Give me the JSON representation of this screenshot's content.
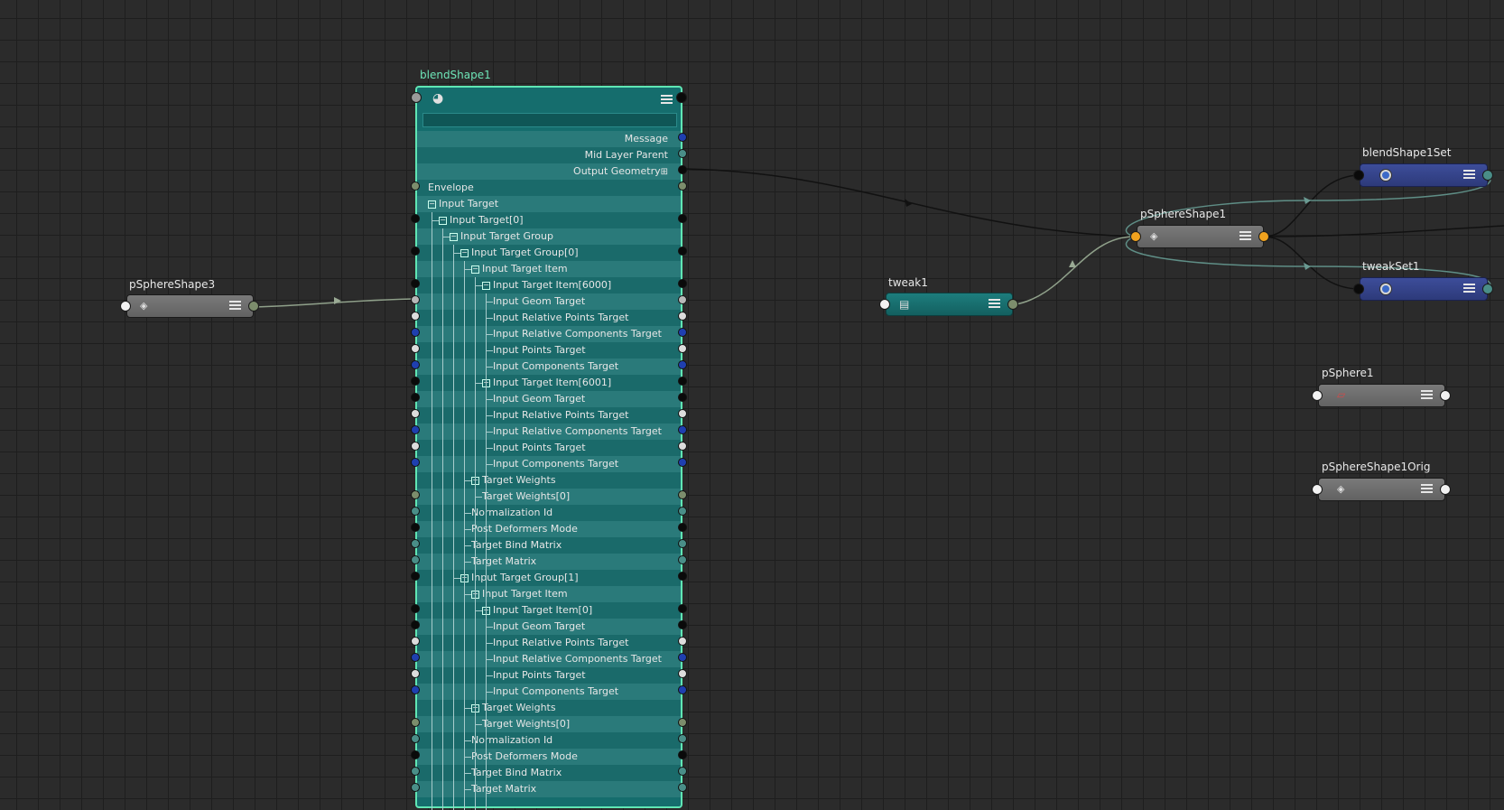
{
  "nodes": {
    "blendShape": {
      "title": "blendShape1",
      "rows": [
        {
          "label": "Message",
          "side": "out",
          "port": "blue"
        },
        {
          "label": "Mid Layer Parent",
          "side": "out",
          "port": "teal"
        },
        {
          "label": "Output Geometry",
          "side": "out",
          "port": "black",
          "expander": "⊞"
        },
        {
          "label": "Envelope",
          "side": "in",
          "depth": 0,
          "port": "olive"
        },
        {
          "label": "Input Target",
          "side": "in",
          "depth": 0,
          "collapse": true,
          "port": "none"
        },
        {
          "label": "Input Target[0]",
          "side": "in",
          "depth": 1,
          "collapse": true,
          "port": "black"
        },
        {
          "label": "Input Target Group",
          "side": "in",
          "depth": 2,
          "collapse": true,
          "port": "none"
        },
        {
          "label": "Input Target Group[0]",
          "side": "in",
          "depth": 3,
          "collapse": true,
          "port": "black"
        },
        {
          "label": "Input Target Item",
          "side": "in",
          "depth": 4,
          "collapse": true,
          "port": "none"
        },
        {
          "label": "Input Target Item[6000]",
          "side": "in",
          "depth": 5,
          "collapse": true,
          "port": "black"
        },
        {
          "label": "Input Geom Target",
          "side": "in",
          "depth": 6,
          "port": "gray"
        },
        {
          "label": "Input Relative Points Target",
          "side": "in",
          "depth": 6,
          "port": "white"
        },
        {
          "label": "Input Relative Components Target",
          "side": "in",
          "depth": 6,
          "port": "blue"
        },
        {
          "label": "Input Points Target",
          "side": "in",
          "depth": 6,
          "port": "white"
        },
        {
          "label": "Input Components Target",
          "side": "in",
          "depth": 6,
          "port": "blue"
        },
        {
          "label": "Input Target Item[6001]",
          "side": "in",
          "depth": 5,
          "collapse": true,
          "port": "black"
        },
        {
          "label": "Input Geom Target",
          "side": "in",
          "depth": 6,
          "port": "black"
        },
        {
          "label": "Input Relative Points Target",
          "side": "in",
          "depth": 6,
          "port": "white"
        },
        {
          "label": "Input Relative Components Target",
          "side": "in",
          "depth": 6,
          "port": "blue"
        },
        {
          "label": "Input Points Target",
          "side": "in",
          "depth": 6,
          "port": "white"
        },
        {
          "label": "Input Components Target",
          "side": "in",
          "depth": 6,
          "port": "blue"
        },
        {
          "label": "Target Weights",
          "side": "in",
          "depth": 4,
          "collapse": true,
          "port": "none"
        },
        {
          "label": "Target Weights[0]",
          "side": "in",
          "depth": 5,
          "port": "olive"
        },
        {
          "label": "Normalization Id",
          "side": "in",
          "depth": 4,
          "port": "teal"
        },
        {
          "label": "Post Deformers Mode",
          "side": "in",
          "depth": 4,
          "port": "black"
        },
        {
          "label": "Target Bind Matrix",
          "side": "in",
          "depth": 4,
          "port": "teal"
        },
        {
          "label": "Target Matrix",
          "side": "in",
          "depth": 4,
          "port": "teal"
        },
        {
          "label": "Input Target Group[1]",
          "side": "in",
          "depth": 3,
          "collapse": true,
          "port": "black"
        },
        {
          "label": "Input Target Item",
          "side": "in",
          "depth": 4,
          "collapse": true,
          "port": "none"
        },
        {
          "label": "Input Target Item[0]",
          "side": "in",
          "depth": 5,
          "collapse": true,
          "port": "black"
        },
        {
          "label": "Input Geom Target",
          "side": "in",
          "depth": 6,
          "port": "black"
        },
        {
          "label": "Input Relative Points Target",
          "side": "in",
          "depth": 6,
          "port": "white"
        },
        {
          "label": "Input Relative Components Target",
          "side": "in",
          "depth": 6,
          "port": "blue"
        },
        {
          "label": "Input Points Target",
          "side": "in",
          "depth": 6,
          "port": "white"
        },
        {
          "label": "Input Components Target",
          "side": "in",
          "depth": 6,
          "port": "blue"
        },
        {
          "label": "Target Weights",
          "side": "in",
          "depth": 4,
          "collapse": true,
          "port": "none"
        },
        {
          "label": "Target Weights[0]",
          "side": "in",
          "depth": 5,
          "port": "olive"
        },
        {
          "label": "Normalization Id",
          "side": "in",
          "depth": 4,
          "port": "teal"
        },
        {
          "label": "Post Deformers Mode",
          "side": "in",
          "depth": 4,
          "port": "black"
        },
        {
          "label": "Target Bind Matrix",
          "side": "in",
          "depth": 4,
          "port": "teal"
        },
        {
          "label": "Target Matrix",
          "side": "in",
          "depth": 4,
          "port": "teal"
        }
      ]
    },
    "pSphereShape3": {
      "title": "pSphereShape3"
    },
    "tweak1": {
      "title": "tweak1"
    },
    "pSphereShape1": {
      "title": "pSphereShape1"
    },
    "blendShape1Set": {
      "title": "blendShape1Set"
    },
    "tweakSet1": {
      "title": "tweakSet1"
    },
    "pSphere1": {
      "title": "pSphere1"
    },
    "pSphereShape1Orig": {
      "title": "pSphereShape1Orig"
    }
  },
  "colors": {
    "background": "#2b2b2b",
    "grid": "#1e1e1e",
    "blendShape_border": "#5fe6b4",
    "blendShape_fill": "#156d6d",
    "port_blue": "#1f3fb0",
    "port_orange": "#f0a21e",
    "wire_black": "#111111",
    "wire_green": "#7f9a7a",
    "wire_teal": "#5f8e86"
  },
  "icons": {
    "shape": "shape-diamonds-icon",
    "blendShape": "blendshape-icon",
    "tweak": "tweak-icon",
    "set": "set-icon",
    "transform": "transform-icon",
    "menu": "attribute-menu-icon"
  }
}
